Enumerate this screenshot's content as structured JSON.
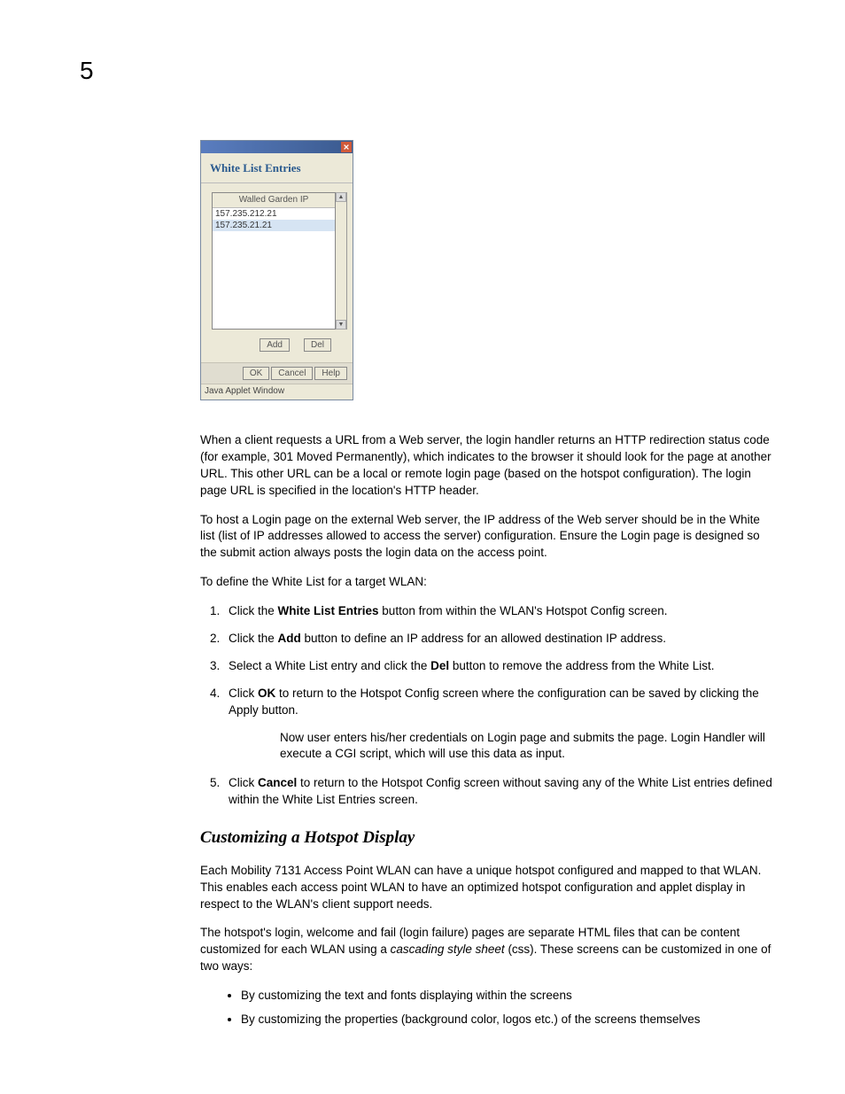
{
  "page_number": "5",
  "dialog": {
    "title": "White List Entries",
    "column_header": "Walled Garden IP",
    "rows": [
      "157.235.212.21",
      "157.235.21.21"
    ],
    "add_btn": "Add",
    "del_btn": "Del",
    "ok_btn": "OK",
    "cancel_btn": "Cancel",
    "help_btn": "Help",
    "status": "Java Applet Window"
  },
  "para1": "When a client requests a URL from a Web server, the login handler returns an HTTP redirection status code (for example, 301 Moved Permanently), which indicates to the browser it should look for the page at another URL. This other URL can be a local or remote login page (based on the hotspot configuration). The login page URL is specified in the location's HTTP header.",
  "para2": "To host a Login page on the external Web server, the IP address of the Web server should be in the White list (list of IP addresses allowed to access the server) configuration. Ensure the Login page is designed so the submit action always posts the login data on the access point.",
  "para3": "To define the White List for a target WLAN:",
  "step1_a": "Click the ",
  "step1_bold": "White List Entries",
  "step1_b": " button from within the WLAN's Hotspot Config screen.",
  "step2_a": "Click the ",
  "step2_bold": "Add",
  "step2_b": " button to define an IP address for an allowed destination IP address.",
  "step3_a": "Select a White List entry and click the ",
  "step3_bold": "Del",
  "step3_b": " button to remove the address from the White List.",
  "step4_a": "Click ",
  "step4_bold": "OK",
  "step4_b": " to return to the Hotspot Config screen where the configuration can be saved by clicking the Apply button.",
  "step4_sub": "Now user enters his/her credentials on Login page and submits the page. Login Handler will execute a CGI script, which will use this data as input.",
  "step5_a": "Click ",
  "step5_bold": "Cancel",
  "step5_b": " to return to the Hotspot Config screen without saving any of the White List entries defined within the White List Entries screen.",
  "section_heading": "Customizing a Hotspot Display",
  "para4": "Each Mobility 7131 Access Point WLAN can have a unique hotspot configured and mapped to that WLAN. This enables each access point WLAN to have an optimized hotspot configuration and applet display in respect to the WLAN's client support needs.",
  "para5_a": "The hotspot's login, welcome and fail (login failure) pages are separate HTML files that can be content customized for each WLAN using a ",
  "para5_it": "cascading style sheet",
  "para5_b": " (css). These screens can be customized in one of two ways:",
  "bullet1": "By customizing the text and fonts displaying within the screens",
  "bullet2": "By customizing the properties (background color, logos etc.) of the screens themselves"
}
